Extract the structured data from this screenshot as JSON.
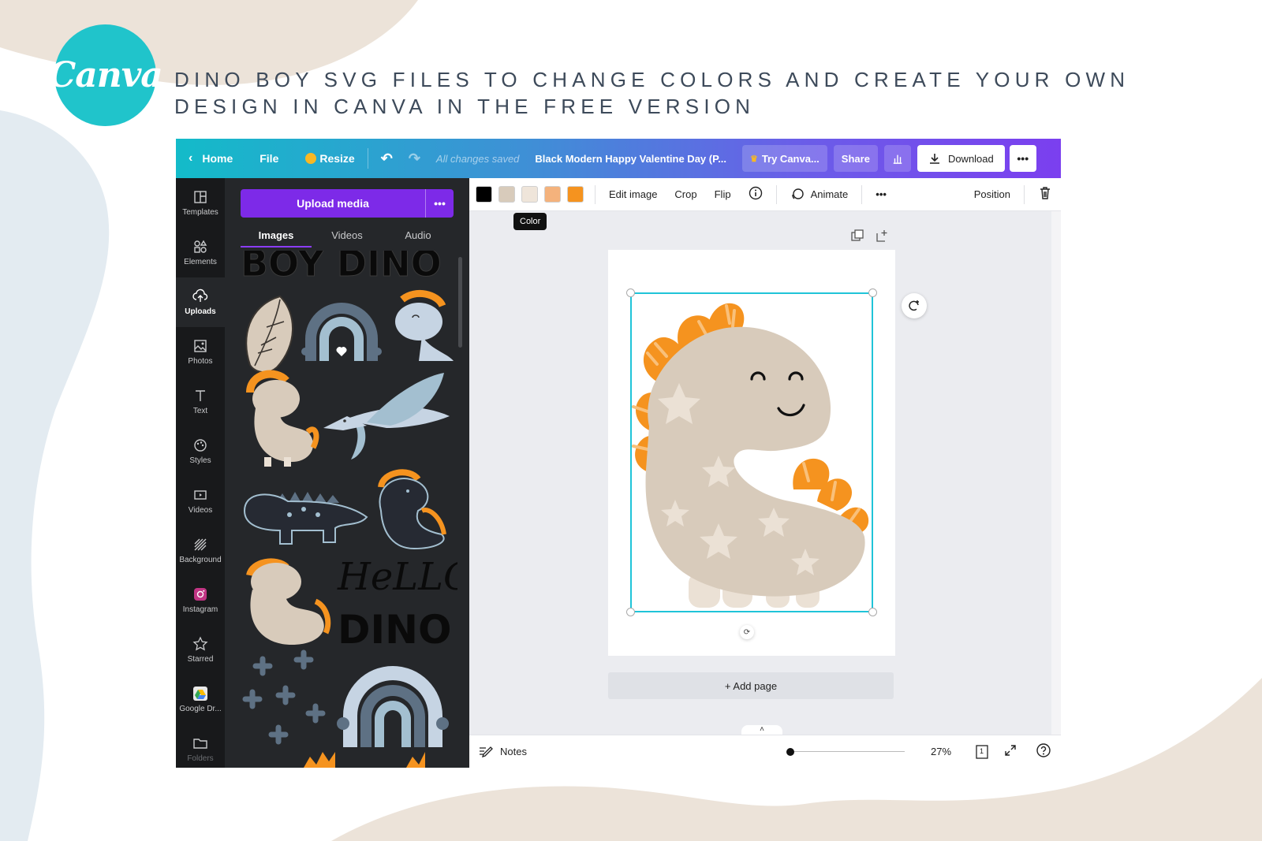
{
  "brand": {
    "logo_text": "Canva",
    "accent": "#20c4cb",
    "purple": "#7d2ae8"
  },
  "headline": "DINO BOY SVG FILES TO CHANGE COLORS AND CREATE YOUR OWN DESIGN IN CANVA IN THE FREE VERSION",
  "topbar": {
    "home": "Home",
    "file": "File",
    "resize": "Resize",
    "saved_status": "All changes saved",
    "doc_title": "Black Modern Happy Valentine Day (P...",
    "try_canva": "Try Canva...",
    "share": "Share",
    "download": "Download"
  },
  "rail": {
    "items": [
      {
        "label": "Templates",
        "icon": "templates-icon"
      },
      {
        "label": "Elements",
        "icon": "elements-icon"
      },
      {
        "label": "Uploads",
        "icon": "uploads-icon"
      },
      {
        "label": "Photos",
        "icon": "photos-icon"
      },
      {
        "label": "Text",
        "icon": "text-icon"
      },
      {
        "label": "Styles",
        "icon": "styles-icon"
      },
      {
        "label": "Videos",
        "icon": "videos-icon"
      },
      {
        "label": "Background",
        "icon": "background-icon"
      },
      {
        "label": "Instagram",
        "icon": "instagram-icon"
      },
      {
        "label": "Starred",
        "icon": "star-icon"
      },
      {
        "label": "Google Dr...",
        "icon": "google-drive-icon"
      },
      {
        "label": "Folders",
        "icon": "folder-icon"
      }
    ]
  },
  "panel": {
    "upload_button": "Upload media",
    "tabs": [
      "Images",
      "Videos",
      "Audio"
    ],
    "gallery": {
      "boy_dino_text": "BOY DINO",
      "hello_text": "HeLLO",
      "dino_text": "DINO"
    }
  },
  "toolbar": {
    "swatches": [
      "#000000",
      "#d8cbbb",
      "#efe5da",
      "#f4b27c",
      "#f5931f"
    ],
    "tooltip": "Color",
    "edit_image": "Edit image",
    "crop": "Crop",
    "flip": "Flip",
    "animate": "Animate",
    "position": "Position"
  },
  "canvas": {
    "add_page": "+ Add page"
  },
  "footer": {
    "notes": "Notes",
    "zoom": "27%",
    "page_count": "1",
    "zoom_fraction": 0.0
  }
}
